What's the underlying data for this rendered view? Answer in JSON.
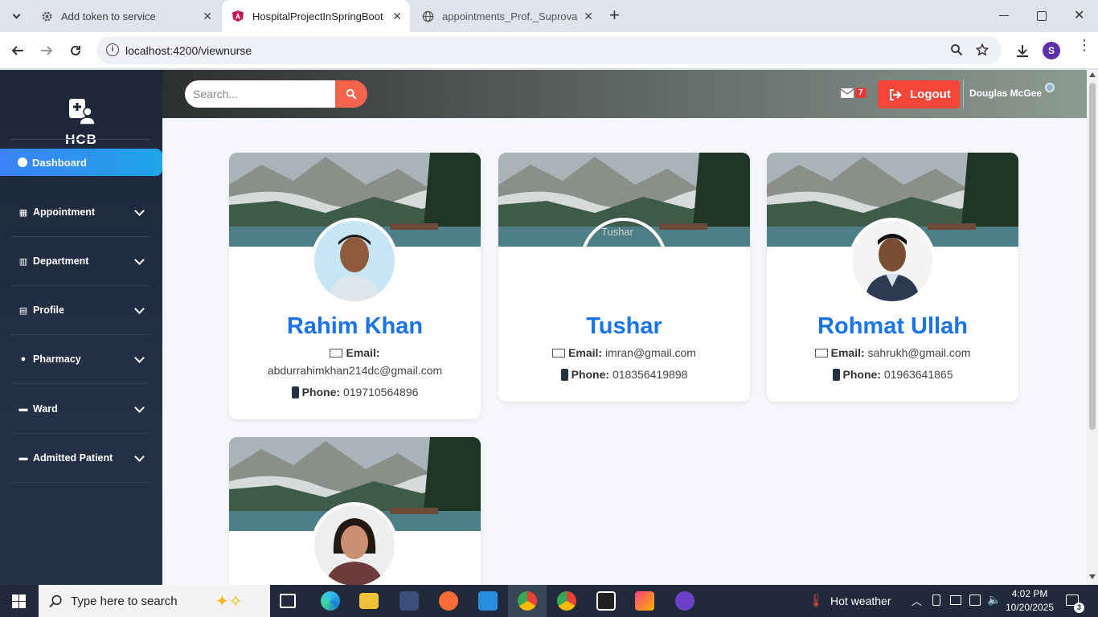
{
  "browser": {
    "tabs": [
      {
        "title": "Add token to service",
        "active": false
      },
      {
        "title": "HospitalProjectInSpringBoot",
        "active": true
      },
      {
        "title": "appointments_Prof._Suprova_Sh",
        "active": false
      }
    ],
    "url": "localhost:4200/viewnurse",
    "profile_initial": "S"
  },
  "sidebar": {
    "brand": "HCB",
    "active_item": "Dashboard",
    "items": [
      {
        "label": "Appointment",
        "icon": "calendar-icon"
      },
      {
        "label": "Department",
        "icon": "building-icon"
      },
      {
        "label": "Profile",
        "icon": "id-card-icon"
      },
      {
        "label": "Pharmacy",
        "icon": "pills-icon"
      },
      {
        "label": "Ward",
        "icon": "bed-icon"
      },
      {
        "label": "Admitted Patient",
        "icon": "bed-icon"
      }
    ]
  },
  "topbar": {
    "search_placeholder": "Search...",
    "mail_count": "7",
    "logout_label": "Logout",
    "user_name": "Douglas McGee"
  },
  "cards": [
    {
      "name": "Rahim Khan",
      "email_label": "Email:",
      "email": "abdurrahimkhan214dc@gmail.com",
      "phone_label": "Phone:",
      "phone": "019710564896",
      "avatar_alt": ""
    },
    {
      "name": "Tushar",
      "email_label": "Email:",
      "email": "imran@gmail.com",
      "phone_label": "Phone:",
      "phone": "018356419898",
      "avatar_alt": "Tushar"
    },
    {
      "name": "Rohmat Ullah",
      "email_label": "Email:",
      "email": "sahrukh@gmail.com",
      "phone_label": "Phone:",
      "phone": "01963641865",
      "avatar_alt": ""
    },
    {
      "name": "",
      "email_label": "",
      "email": "",
      "phone_label": "",
      "phone": "",
      "avatar_alt": ""
    }
  ],
  "taskbar": {
    "search_placeholder": "Type here to search",
    "weather": "Hot weather",
    "time": "4:02 PM",
    "date": "10/20/2025",
    "notification_count": "3"
  },
  "colors": {
    "accent": "#1a73e8",
    "logout": "#f4473a",
    "search_button": "#f4644d",
    "sidebar": "#1e2738"
  }
}
